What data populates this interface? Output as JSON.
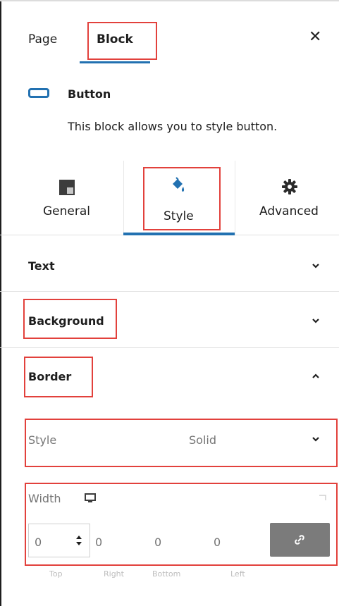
{
  "header": {
    "tabs": [
      {
        "label": "Page",
        "active": false
      },
      {
        "label": "Block",
        "active": true
      }
    ],
    "close_icon": "close-icon"
  },
  "block_card": {
    "icon": "button-icon",
    "title": "Button",
    "description": "This block allows you to style button."
  },
  "subtabs": [
    {
      "label": "General",
      "icon": "general-icon",
      "active": false
    },
    {
      "label": "Style",
      "icon": "paint-bucket-icon",
      "active": true
    },
    {
      "label": "Advanced",
      "icon": "gear-icon",
      "active": false
    }
  ],
  "sections": {
    "text": {
      "title": "Text",
      "expanded": false
    },
    "background": {
      "title": "Background",
      "expanded": false
    },
    "border": {
      "title": "Border",
      "expanded": true
    }
  },
  "border_controls": {
    "style": {
      "label": "Style",
      "value": "Solid"
    },
    "width": {
      "label": "Width",
      "device_icon": "desktop-icon",
      "values": [
        "0",
        "0",
        "0",
        "0"
      ],
      "side_labels": [
        "Top",
        "Right",
        "Bottom",
        "Left"
      ]
    },
    "link_icon": "link-icon"
  },
  "colors": {
    "accent": "#2271b1",
    "highlight": "#e2413c",
    "link_button": "#7b7b7b"
  }
}
